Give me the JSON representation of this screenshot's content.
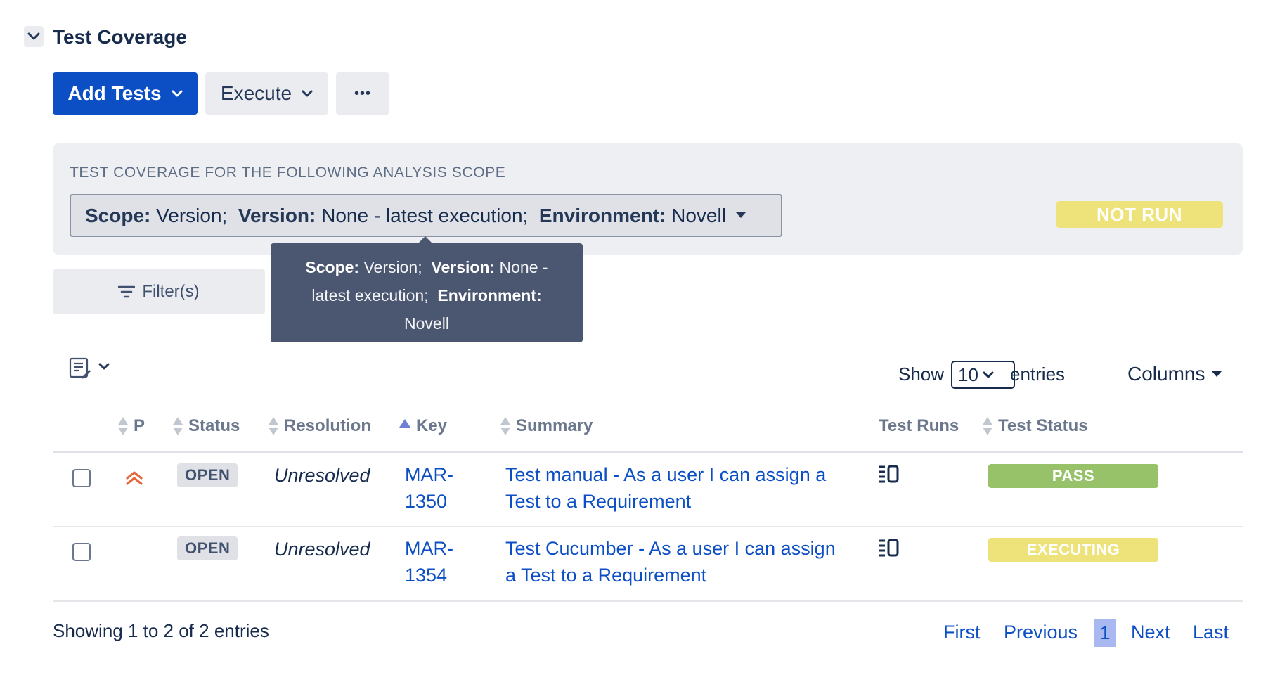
{
  "section": {
    "title": "Test Coverage"
  },
  "toolbar": {
    "add_tests_label": "Add Tests",
    "execute_label": "Execute",
    "more_label": "•••"
  },
  "scope": {
    "heading": "TEST COVERAGE FOR THE FOLLOWING ANALYSIS SCOPE",
    "scope_key": "Scope:",
    "scope_value": "Version;",
    "version_key": "Version:",
    "version_value": "None - latest execution;",
    "environment_key": "Environment:",
    "environment_value": "Novell",
    "overall_status": "NOT RUN"
  },
  "filter": {
    "label": "Filter(s)"
  },
  "tooltip": {
    "scope_key": "Scope:",
    "scope_value": "Version;",
    "version_key": "Version:",
    "version_value_line1": "None -",
    "version_value_line2": "latest execution;",
    "environment_key": "Environment:",
    "environment_value": "Novell"
  },
  "table_controls": {
    "show_label": "Show",
    "page_size": "10",
    "entries_label": "entries",
    "columns_label": "Columns"
  },
  "table": {
    "headers": {
      "priority": "P",
      "status": "Status",
      "resolution": "Resolution",
      "key": "Key",
      "summary": "Summary",
      "test_runs": "Test Runs",
      "test_status": "Test Status"
    },
    "rows": [
      {
        "priority": "high",
        "status": "OPEN",
        "resolution": "Unresolved",
        "key_line1": "MAR-",
        "key_line2": "1350",
        "summary_line1": "Test manual - As a user I can assign a",
        "summary_line2": "Test to a Requirement",
        "test_status": "PASS",
        "test_status_color": "#97c26a"
      },
      {
        "priority": "",
        "status": "OPEN",
        "resolution": "Unresolved",
        "key_line1": "MAR-",
        "key_line2": "1354",
        "summary_line1": "Test Cucumber - As a user I can assign",
        "summary_line2": "a Test to a Requirement",
        "test_status": "EXECUTING",
        "test_status_color": "#eee27a"
      }
    ]
  },
  "footer": {
    "showing_text": "Showing 1 to 2 of 2 entries",
    "first": "First",
    "previous": "Previous",
    "current_page": "1",
    "next": "Next",
    "last": "Last"
  },
  "colors": {
    "primary": "#0c4fc4",
    "not_run": "#eee27a",
    "pass": "#97c26a",
    "executing": "#eee27a",
    "priority_high": "#e5683d"
  }
}
